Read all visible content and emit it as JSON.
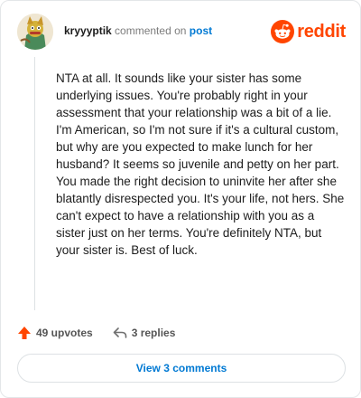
{
  "header": {
    "author": "kryyyptik",
    "action_text": "commented on",
    "post_link": "post",
    "brand": "reddit"
  },
  "comment": {
    "body": "NTA at all. It sounds like your sister has some underlying issues. You're probably right in your assessment that your relationship was a bit of a lie. I'm American, so I'm not sure if it's a cultural custom, but why are you expected to make lunch for her husband? It seems so juvenile and petty on her part. You made the right decision to uninvite her after she blatantly disrespected you. It's your life, not hers. She can't expect to have a relationship with you as a sister just on her terms. You're definitely NTA, but your sister is. Best of luck."
  },
  "stats": {
    "upvotes": "49 upvotes",
    "replies": "3 replies"
  },
  "footer": {
    "view_comments": "View 3 comments"
  },
  "colors": {
    "brand": "#ff4500",
    "link": "#0079d3"
  },
  "icons": {
    "upvote": "arrow-up-icon",
    "reply": "reply-arrow-icon",
    "brand": "reddit-snoo-icon",
    "avatar": "user-avatar"
  }
}
